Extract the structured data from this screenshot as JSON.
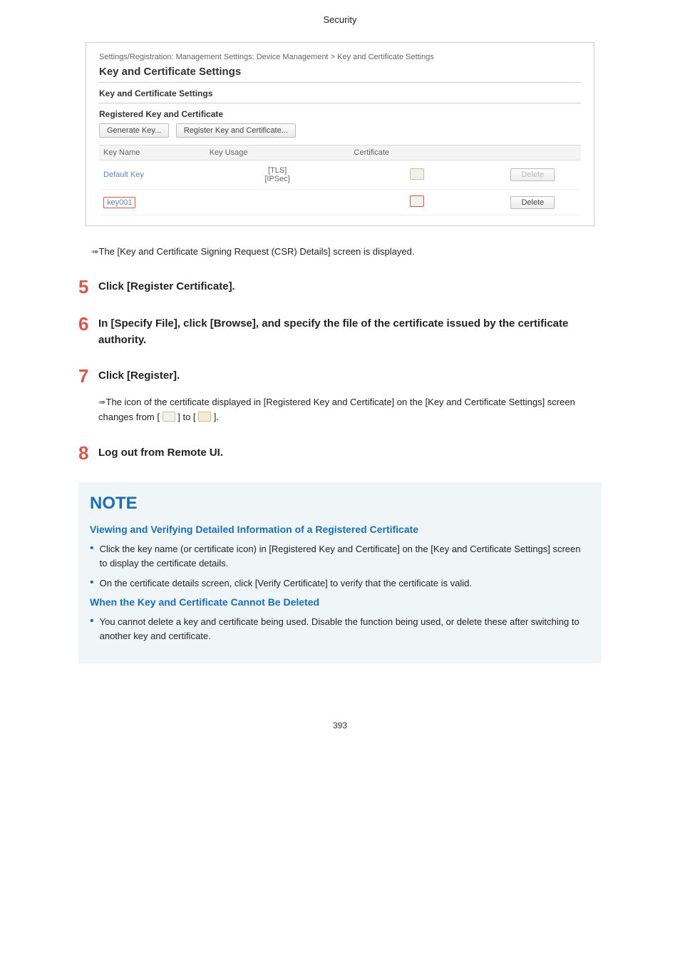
{
  "header": {
    "title": "Security"
  },
  "screenshot": {
    "breadcrumb": "Settings/Registration: Management Settings: Device Management > Key and Certificate Settings",
    "title": "Key and Certificate Settings",
    "subhead1": "Key and Certificate Settings",
    "subhead2": "Registered Key and Certificate",
    "btn_generate": "Generate Key...",
    "btn_register": "Register Key and Certificate...",
    "cols": {
      "name": "Key Name",
      "usage": "Key Usage",
      "cert": "Certificate",
      "action": ""
    },
    "rows": [
      {
        "name": "Default Key",
        "usage": "[TLS]\n[IPSec]",
        "delete": "Delete",
        "delete_state": "disabled"
      },
      {
        "name": "key001",
        "usage": "",
        "delete": "Delete",
        "delete_state": "enabled",
        "highlight": true
      }
    ]
  },
  "result_after_screenshot": "The [Key and Certificate Signing Request (CSR) Details] screen is displayed.",
  "steps": {
    "5": {
      "num": "5",
      "text": "Click [Register Certificate]."
    },
    "6": {
      "num": "6",
      "text": "In [Specify File], click [Browse], and specify the file of the certificate issued by the certificate authority."
    },
    "7": {
      "num": "7",
      "text": "Click [Register].",
      "sub_before": "The icon of the certificate displayed in [Registered Key and Certificate] on the [Key and Certificate Settings] screen changes from [ ",
      "sub_mid": " ] to [ ",
      "sub_after": " ]."
    },
    "8": {
      "num": "8",
      "text": "Log out from Remote UI."
    }
  },
  "note": {
    "title": "NOTE",
    "sub1": "Viewing and Verifying Detailed Information of a Registered Certificate",
    "b1": "Click the key name (or certificate icon) in [Registered Key and Certificate] on the [Key and Certificate Settings] screen to display the certificate details.",
    "b2": "On the certificate details screen, click [Verify Certificate] to verify that the certificate is valid.",
    "sub2": "When the Key and Certificate Cannot Be Deleted",
    "b3": "You cannot delete a key and certificate being used. Disable the function being used, or delete these after switching to another key and certificate."
  },
  "page_number": "393"
}
